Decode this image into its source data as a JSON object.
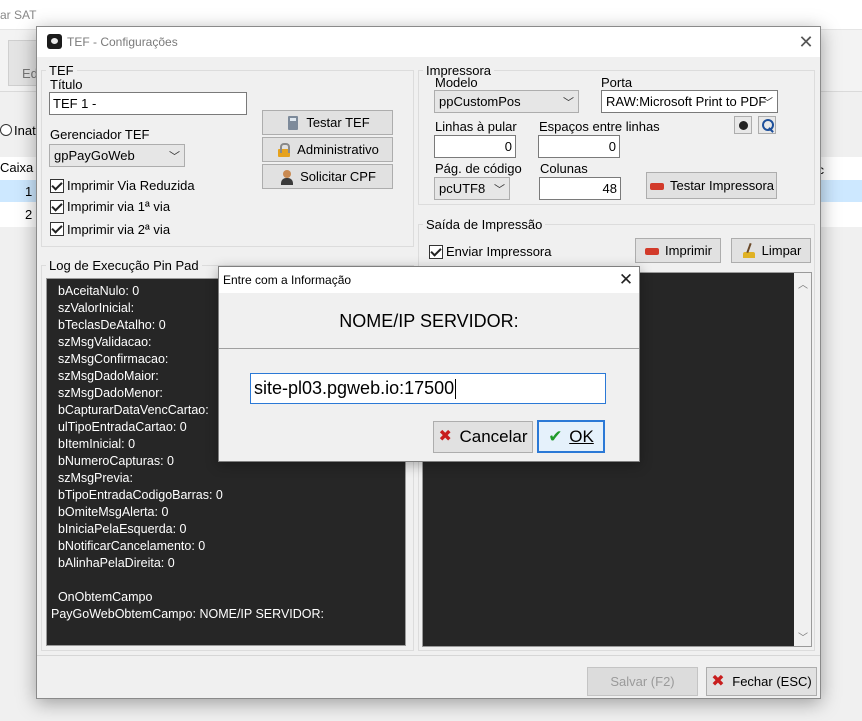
{
  "background": {
    "title": "ar SAT",
    "toolbar_button_label": "Ed",
    "radio_label": "Inati",
    "grid_header": "Caixa",
    "grid_header_right": "c",
    "rows": [
      "1",
      "2"
    ]
  },
  "window": {
    "title": "TEF - Configurações",
    "close": "✕"
  },
  "tef": {
    "group": "TEF",
    "titulo_label": "Título",
    "titulo_value": "TEF 1 -",
    "gerenciador_label": "Gerenciador TEF",
    "gerenciador_value": "gpPayGoWeb",
    "checkboxes": [
      "Imprimir Via Reduzida",
      "Imprimir via 1ª via",
      "Imprimir via 2ª via"
    ],
    "buttons": {
      "testar": "Testar TEF",
      "administrativo": "Administrativo",
      "solicitar_cpf": "Solicitar CPF"
    }
  },
  "impressora": {
    "group": "Impressora",
    "modelo_label": "Modelo",
    "modelo_value": "ppCustomPos",
    "porta_label": "Porta",
    "porta_value": "RAW:Microsoft Print to PDF",
    "linhas_label": "Linhas à pular",
    "linhas_value": "0",
    "espacos_label": "Espaços entre linhas",
    "espacos_value": "0",
    "pagcodigo_label": "Pág. de código",
    "pagcodigo_value": "pcUTF8",
    "colunas_label": "Colunas",
    "colunas_value": "48",
    "testar_btn": "Testar Impressora"
  },
  "saida": {
    "group": "Saída de Impressão",
    "enviar_label": "Enviar Impressora",
    "imprimir_btn": "Imprimir",
    "limpar_btn": "Limpar"
  },
  "log": {
    "group": "Log de Execução Pin Pad",
    "lines": [
      "  bAceitaNulo: 0",
      "  szValorInicial:",
      "  bTeclasDeAtalho: 0",
      "  szMsgValidacao:",
      "  szMsgConfirmacao:",
      "  szMsgDadoMaior:",
      "  szMsgDadoMenor:",
      "  bCapturarDataVencCartao:",
      "  ulTipoEntradaCartao: 0",
      "  bItemInicial: 0",
      "  bNumeroCapturas: 0",
      "  szMsgPrevia:",
      "  bTipoEntradaCodigoBarras: 0",
      "  bOmiteMsgAlerta: 0",
      "  bIniciaPelaEsquerda: 0",
      "  bNotificarCancelamento: 0",
      "  bAlinhaPelaDireita: 0",
      "",
      "  OnObtemCampo",
      "PayGoWebObtemCampo: NOME/IP SERVIDOR:"
    ]
  },
  "footer": {
    "salvar": "Salvar (F2)",
    "fechar": "Fechar (ESC)"
  },
  "modal": {
    "title": "Entre com a Informação",
    "close": "✕",
    "message": "NOME/IP SERVIDOR:",
    "input_value": "site-pl03.pgweb.io:17500",
    "cancel": "Cancelar",
    "ok": "OK"
  }
}
